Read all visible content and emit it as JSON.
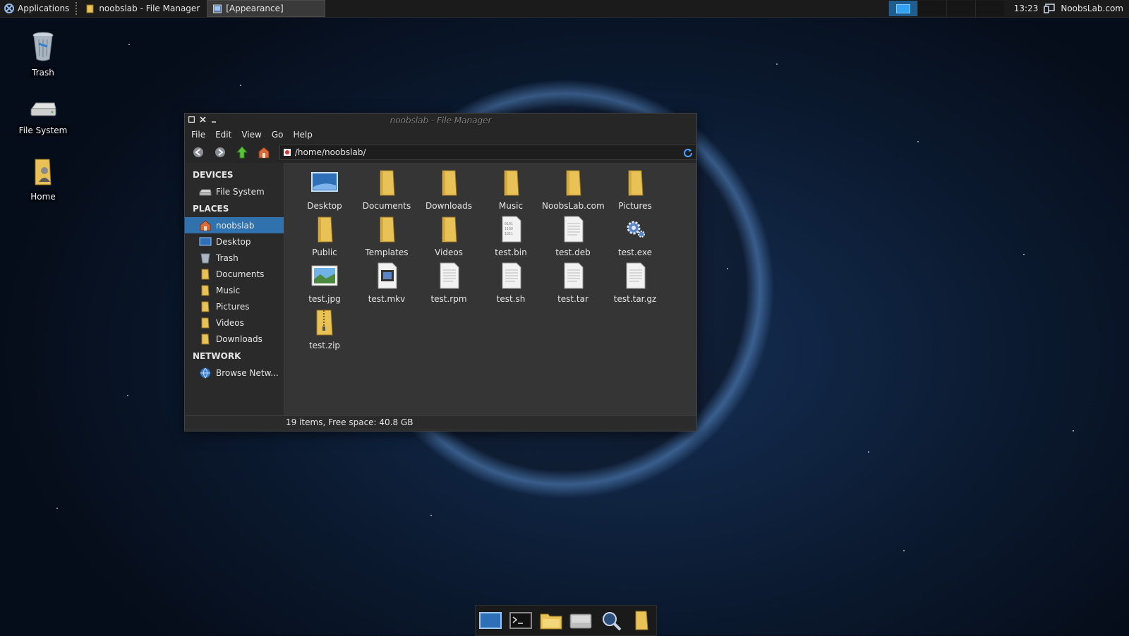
{
  "top_panel": {
    "applications_label": "Applications",
    "tasks": [
      {
        "label": "noobslab - File Manager",
        "active": false
      },
      {
        "label": "[Appearance]",
        "active": true
      }
    ],
    "clock": "13:23",
    "user": "NoobsLab.com"
  },
  "desktop_icons": [
    {
      "label": "Trash",
      "icon": "trash-icon"
    },
    {
      "label": "File System",
      "icon": "drive-icon"
    },
    {
      "label": "Home",
      "icon": "home-folder-icon"
    }
  ],
  "window": {
    "title": "noobslab - File Manager",
    "menu": [
      "File",
      "Edit",
      "View",
      "Go",
      "Help"
    ],
    "location_path": "/home/noobslab/",
    "sidebar": {
      "devices_header": "DEVICES",
      "devices": [
        {
          "label": "File System",
          "icon": "drive-icon"
        }
      ],
      "places_header": "PLACES",
      "places": [
        {
          "label": "noobslab",
          "icon": "home-icon",
          "active": true
        },
        {
          "label": "Desktop",
          "icon": "desktop-icon"
        },
        {
          "label": "Trash",
          "icon": "trash-icon"
        },
        {
          "label": "Documents",
          "icon": "folder-icon"
        },
        {
          "label": "Music",
          "icon": "folder-icon"
        },
        {
          "label": "Pictures",
          "icon": "folder-icon"
        },
        {
          "label": "Videos",
          "icon": "folder-icon"
        },
        {
          "label": "Downloads",
          "icon": "folder-icon"
        }
      ],
      "network_header": "NETWORK",
      "network": [
        {
          "label": "Browse Netw...",
          "icon": "network-icon"
        }
      ]
    },
    "files": [
      {
        "label": "Desktop",
        "icon": "desktop-folder-icon"
      },
      {
        "label": "Documents",
        "icon": "folder-icon"
      },
      {
        "label": "Downloads",
        "icon": "folder-icon"
      },
      {
        "label": "Music",
        "icon": "folder-icon"
      },
      {
        "label": "NoobsLab.com",
        "icon": "folder-icon"
      },
      {
        "label": "Pictures",
        "icon": "folder-icon"
      },
      {
        "label": "Public",
        "icon": "folder-icon"
      },
      {
        "label": "Templates",
        "icon": "folder-icon"
      },
      {
        "label": "Videos",
        "icon": "folder-icon"
      },
      {
        "label": "test.bin",
        "icon": "binary-file-icon"
      },
      {
        "label": "test.deb",
        "icon": "text-file-icon"
      },
      {
        "label": "test.exe",
        "icon": "gear-file-icon"
      },
      {
        "label": "test.jpg",
        "icon": "image-file-icon"
      },
      {
        "label": "test.mkv",
        "icon": "video-file-icon"
      },
      {
        "label": "test.rpm",
        "icon": "text-file-icon"
      },
      {
        "label": "test.sh",
        "icon": "text-file-icon"
      },
      {
        "label": "test.tar",
        "icon": "text-file-icon"
      },
      {
        "label": "test.tar.gz",
        "icon": "text-file-icon"
      },
      {
        "label": "test.zip",
        "icon": "zip-file-icon"
      }
    ],
    "status": "19 items, Free space: 40.8 GB"
  },
  "dock": [
    "desktop-icon",
    "terminal-icon",
    "file-manager-icon",
    "drive-icon",
    "search-icon",
    "folder-icon"
  ]
}
